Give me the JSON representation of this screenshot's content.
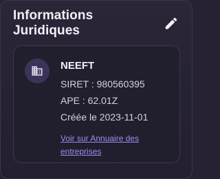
{
  "header": {
    "title": "Informations Juridiques",
    "edit_icon": "pencil-icon"
  },
  "company": {
    "icon": "building-icon",
    "name": "NEEFT",
    "siret": "SIRET : 980560395",
    "ape": "APE : 62.01Z",
    "created": "Créée le 2023-11-01",
    "link_label": "Voir sur Annuaire des entreprises"
  },
  "colors": {
    "background": "#262234",
    "card": "#211e2e",
    "avatar": "#3b3458",
    "link": "#a08ef0",
    "text": "#f2f0f7"
  }
}
